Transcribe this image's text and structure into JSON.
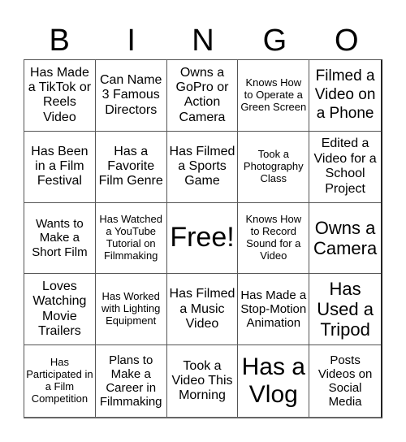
{
  "header": {
    "letters": [
      "B",
      "I",
      "N",
      "G",
      "O"
    ]
  },
  "cells": [
    [
      "Has Made a TikTok or Reels Video",
      "Can Name 3 Famous Directors",
      "Owns a GoPro or Action Camera",
      "Knows How to Operate a Green Screen",
      "Filmed a Video on a Phone"
    ],
    [
      "Has Been in a Film Festival",
      "Has a Favorite Film Genre",
      "Has Filmed a Sports Game",
      "Took a Photography Class",
      "Edited a Video for a School Project"
    ],
    [
      "Wants to Make a Short Film",
      "Has Watched a YouTube Tutorial on Filmmaking",
      "Free!",
      "Knows How to Record Sound for a Video",
      "Owns a Camera"
    ],
    [
      "Loves Watching Movie Trailers",
      "Has Worked with Lighting Equipment",
      "Has Filmed a Music Video",
      "Has Made a Stop-Motion Animation",
      "Has Used a Tripod"
    ],
    [
      "Has Participated in a Film Competition",
      "Plans to Make a Career in Filmmaking",
      "Took a Video This Morning",
      "Has a Vlog",
      "Posts Videos on Social Media"
    ]
  ]
}
